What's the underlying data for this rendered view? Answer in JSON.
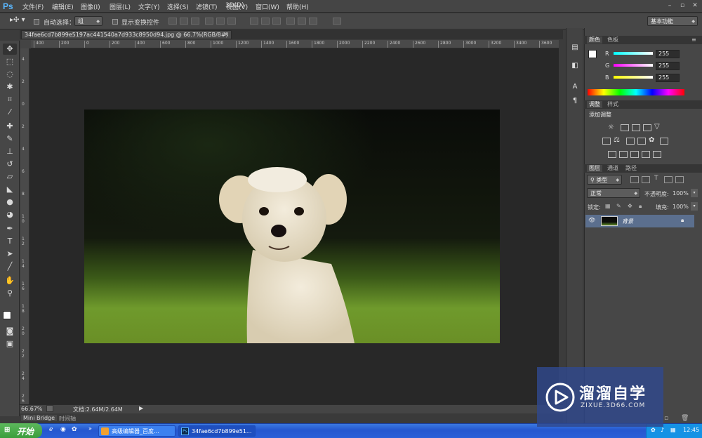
{
  "app": {
    "logo": "Ps"
  },
  "menu": [
    "文件(F)",
    "编辑(E)",
    "图像(I)",
    "图层(L)",
    "文字(Y)",
    "选择(S)",
    "滤镜(T)",
    "3D(D)",
    "视图(V)",
    "窗口(W)",
    "帮助(H)"
  ],
  "options": {
    "auto_select_label": "自动选择：",
    "auto_select_value": "组",
    "show_transform_label": "显示变换控件",
    "workspace": "基本功能"
  },
  "document": {
    "tab_title": "34fae6cd7b899e5197ac441540a7d933c8950d94.jpg @ 66.7%(RGB/8#)"
  },
  "ruler_h": [
    "400",
    "200",
    "0",
    "200",
    "400",
    "600",
    "800",
    "1000",
    "1200",
    "1400",
    "1600",
    "1800",
    "2000",
    "2200",
    "2400",
    "2600",
    "2800",
    "3000",
    "3200",
    "3400",
    "3600"
  ],
  "ruler_v": [
    "4",
    "2",
    "0",
    "2",
    "4",
    "6",
    "8",
    "1 0",
    "1 2",
    "1 4",
    "1 6",
    "1 8",
    "2 0",
    "2 2",
    "2 4",
    "2 6"
  ],
  "status": {
    "zoom": "66.67%",
    "doc_size": "文档:2.64M/2.64M"
  },
  "bottom_tabs": [
    "Mini Bridge",
    "时间轴"
  ],
  "color_panel": {
    "tabs": [
      "颜色",
      "色板"
    ],
    "channels": [
      {
        "label": "R",
        "value": "255",
        "color": "#e05050"
      },
      {
        "label": "G",
        "value": "255",
        "color": "#50c050"
      },
      {
        "label": "B",
        "value": "255",
        "color": "#5070e0"
      }
    ]
  },
  "adjust_panel": {
    "tabs": [
      "调整",
      "样式"
    ],
    "title": "添加调整"
  },
  "layers_panel": {
    "tabs": [
      "图层",
      "通道",
      "路径"
    ],
    "filter_kind": "类型",
    "blend_mode": "正常",
    "opacity_label": "不透明度:",
    "opacity": "100%",
    "lock_label": "锁定:",
    "fill_label": "填充:",
    "fill": "100%",
    "layer_name": "背景"
  },
  "taskbar": {
    "start": "开始",
    "tasks": [
      "高级编辑器_百度...",
      "34fae6cd7b899e51..."
    ],
    "clock": "12:45"
  },
  "watermark": {
    "brand": "溜溜自学",
    "url": "ZIXUE.3D66.COM"
  }
}
